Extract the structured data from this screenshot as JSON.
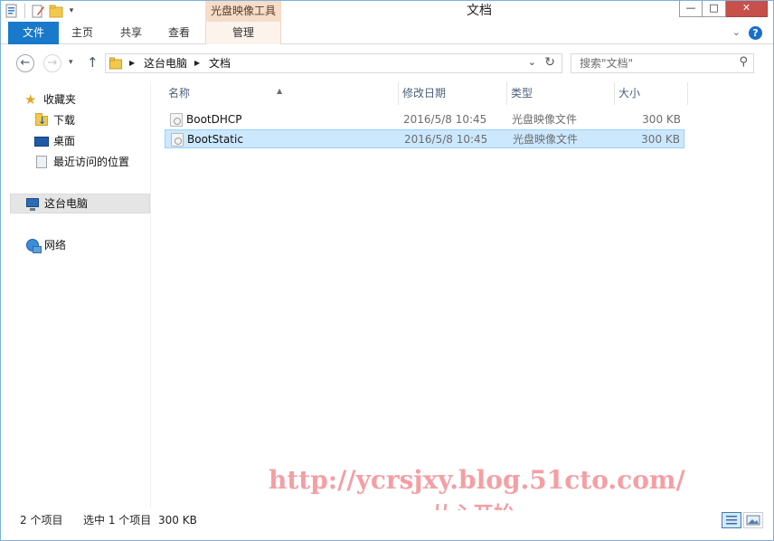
{
  "window": {
    "title": "文档",
    "context_tab_group": "光盘映像工具",
    "controls": {
      "minimize": "—",
      "maximize": "□",
      "close": "✕"
    }
  },
  "ribbon": {
    "tabs": [
      {
        "label": "文件"
      },
      {
        "label": "主页"
      },
      {
        "label": "共享"
      },
      {
        "label": "查看"
      },
      {
        "label": "管理"
      }
    ],
    "expand_glyph": "⌄",
    "help_glyph": "?"
  },
  "nav": {
    "breadcrumb": [
      "这台电脑",
      "文档"
    ],
    "search_placeholder": "搜索\"文档\""
  },
  "sidebar": {
    "favorites": {
      "label": "收藏夹",
      "items": [
        {
          "label": "下载",
          "icon": "downloads-folder-icon"
        },
        {
          "label": "桌面",
          "icon": "desktop-icon"
        },
        {
          "label": "最近访问的位置",
          "icon": "recent-places-icon"
        }
      ]
    },
    "this_pc": {
      "label": "这台电脑",
      "icon": "computer-icon"
    },
    "network": {
      "label": "网络",
      "icon": "network-icon"
    }
  },
  "columns": {
    "name": "名称",
    "date": "修改日期",
    "type": "类型",
    "size": "大小"
  },
  "files": [
    {
      "name": "BootDHCP",
      "date": "2016/5/8 10:45",
      "type": "光盘映像文件",
      "size": "300 KB",
      "selected": false
    },
    {
      "name": "BootStatic",
      "date": "2016/5/8 10:45",
      "type": "光盘映像文件",
      "size": "300 KB",
      "selected": true
    }
  ],
  "status": {
    "item_count": "2 个项目",
    "selected": "选中 1 个项目",
    "selected_size": "300 KB"
  },
  "watermark": {
    "url": "http://ycrsjxy.blog.51cto.com/",
    "slogan": "从心开始"
  },
  "colors": {
    "accent": "#1979ca",
    "context_tab": "#f7dcc9",
    "selection": "#cce8ff",
    "watermark": "#f49aa0"
  }
}
